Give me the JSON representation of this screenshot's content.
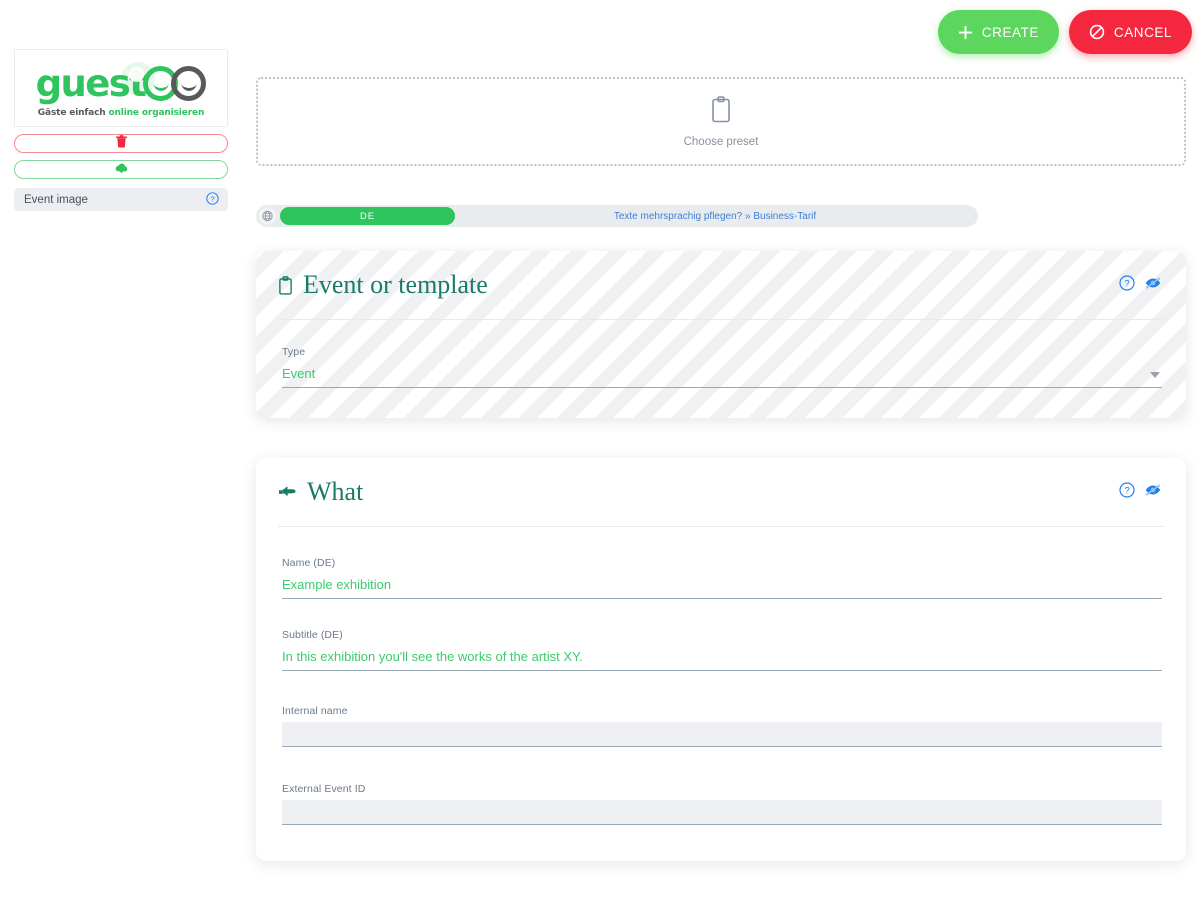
{
  "topbar": {
    "create_label": "CREATE",
    "cancel_label": "CANCEL",
    "create_color": "#5cd65c",
    "cancel_color": "#f5273f"
  },
  "sidebar": {
    "logo": {
      "word": "guest",
      "tagline_1": "Gäste einfach ",
      "tagline_online": "online",
      "tagline_2": " ",
      "tagline_organisieren": "organisieren",
      "brand_green": "#2ec45e",
      "brand_gray": "#58595b"
    },
    "delete_button_name": "delete-image-button",
    "download_button_name": "download-image-button",
    "image_label": "Event image"
  },
  "preset": {
    "label": "Choose preset",
    "icon": "clipboard-icon"
  },
  "language_bar": {
    "globe_icon": "globe-icon",
    "active_language": "DE",
    "note": "Texte mehrsprachig pflegen? » Business-Tarif",
    "note_color": "#3d7fd6",
    "active_color": "#2ec45e"
  },
  "cards": [
    {
      "id": "event-or-template",
      "title": "Event or template",
      "icon": "clipboard-icon",
      "help_icon": "help-circle-icon",
      "hide_icon": "eye-slash-icon",
      "fields": [
        {
          "name": "type",
          "label": "Type",
          "value": "Event",
          "kind": "select"
        }
      ]
    },
    {
      "id": "what",
      "title": "What",
      "icon": "pointing-hand-icon",
      "help_icon": "help-circle-icon",
      "hide_icon": "eye-slash-icon",
      "fields": [
        {
          "name": "name-de",
          "label": "Name (DE)",
          "value": "Example exhibition",
          "kind": "text"
        },
        {
          "name": "subtitle-de",
          "label": "Subtitle (DE)",
          "value": "In this exhibition you'll see the works of the artist XY.",
          "kind": "text"
        },
        {
          "name": "internal-name",
          "label": "Internal name",
          "value": "",
          "kind": "text-empty"
        },
        {
          "name": "external-event-id",
          "label": "External Event ID",
          "value": "",
          "kind": "text-empty"
        }
      ]
    }
  ],
  "colors": {
    "heading": "#1b7a68",
    "value_green": "#3ccb6e",
    "label_gray": "#6b7a8c",
    "icon_blue": "#2680eb"
  }
}
